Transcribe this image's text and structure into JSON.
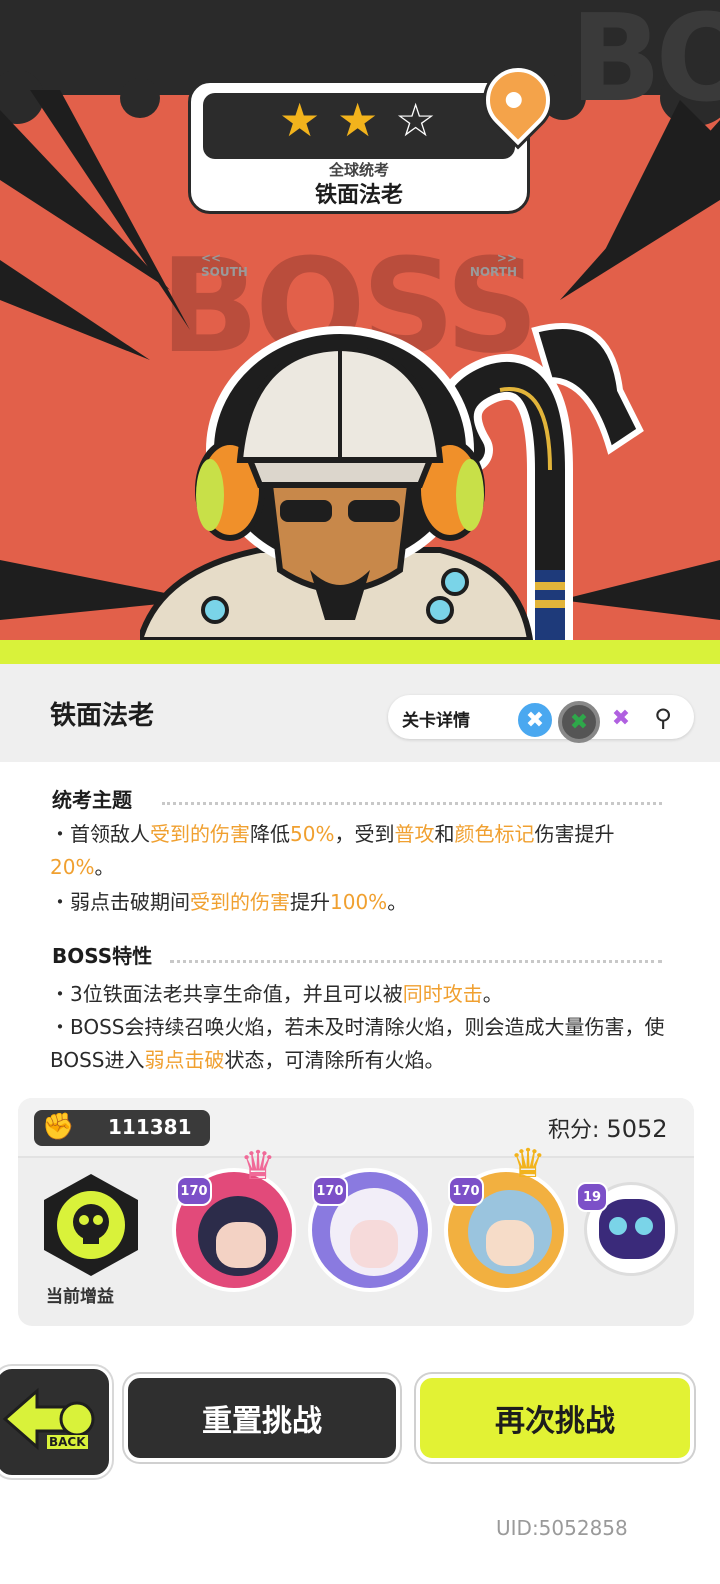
{
  "stage": {
    "stars_filled": 2,
    "stars_total": 3,
    "nav_prev": "SOUTH",
    "nav_next": "NORTH",
    "subtitle": "全球统考",
    "title": "铁面法老",
    "watermark": "BOSS"
  },
  "panel": {
    "boss_name": "铁面法老",
    "detail_label": "关卡详情",
    "badges": [
      "blue-cross-icon",
      "green-cross-icon",
      "purple-cross-icon",
      "magnifier-icon"
    ]
  },
  "exam_theme": {
    "heading": "统考主题",
    "line1": [
      "・首领敌人",
      "受到的伤害",
      "降低",
      "50%",
      "，受到",
      "普攻",
      "和",
      "颜色标记",
      "伤害提升",
      "20%",
      "。"
    ],
    "line2": [
      "・弱点击破期间",
      "受到的伤害",
      "提升",
      "100%",
      "。"
    ]
  },
  "boss_traits": {
    "heading": "BOSS特性",
    "line1": [
      "・3位铁面法老共享生命值，并且可以被",
      "同时攻击",
      "。"
    ],
    "line2": [
      "・BOSS会持续召唤火焰，若未及时清除火焰，则会造成大量伤害，使BOSS进入",
      "弱点击破",
      "状态，可清除所有火焰。"
    ]
  },
  "team": {
    "power": "111381",
    "score_label": "积分:",
    "score_value": "5052",
    "buff_label": "当前增益",
    "members": [
      {
        "level": "170",
        "crown": true,
        "color": "#e24a7a"
      },
      {
        "level": "170",
        "crown": false,
        "color": "#8a7ae0"
      },
      {
        "level": "170",
        "crown": true,
        "color": "#f2b040"
      },
      {
        "level": "19",
        "crown": false,
        "color": "#ffffff"
      }
    ]
  },
  "buttons": {
    "back": "BACK",
    "reset": "重置挑战",
    "retry": "再次挑战"
  },
  "footer": {
    "uid": "UID:5052858"
  },
  "colors": {
    "hero_red": "#e2604a",
    "lime": "#d9f23a",
    "highlight": "#f0a030",
    "dark": "#2f2f2f"
  }
}
